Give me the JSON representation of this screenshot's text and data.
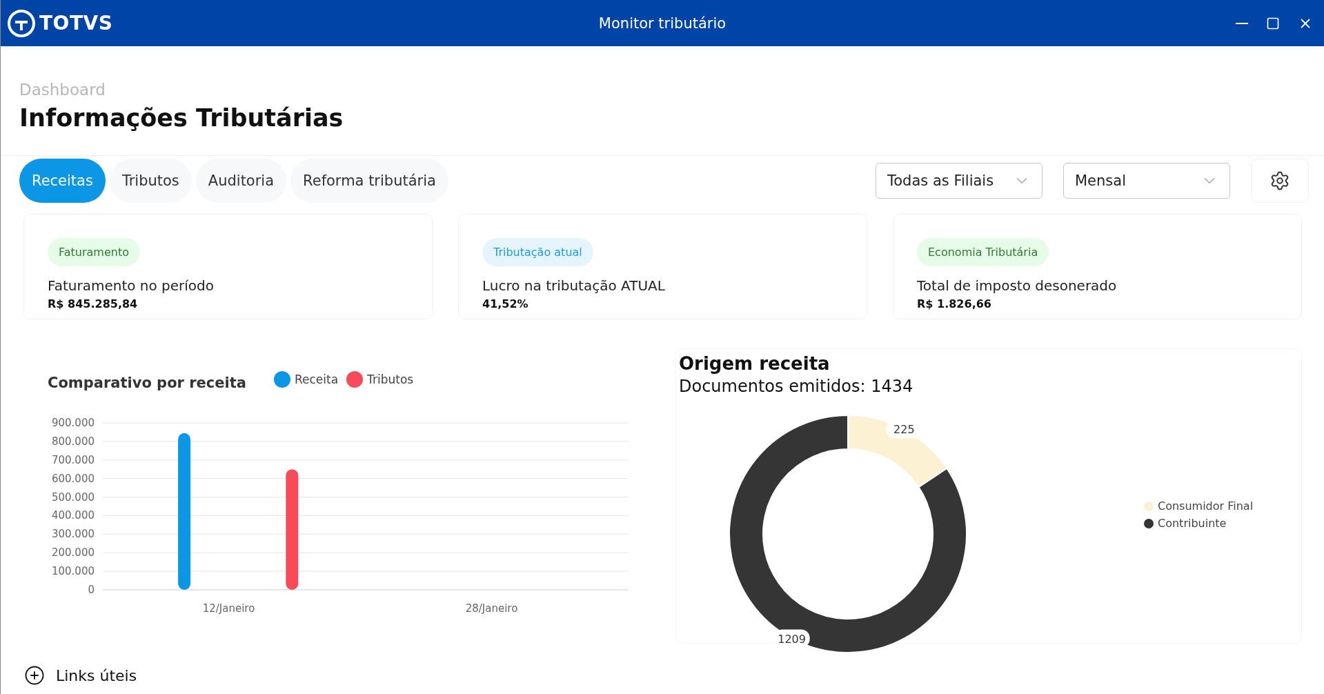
{
  "window": {
    "title": "Monitor tributário",
    "logo": "TOTVS"
  },
  "header": {
    "breadcrumb": "Dashboard",
    "title": "Informações Tributárias"
  },
  "tabs": [
    {
      "label": "Receitas",
      "selected": true
    },
    {
      "label": "Tributos",
      "selected": false
    },
    {
      "label": "Auditoria",
      "selected": false
    },
    {
      "label": "Reforma tributária",
      "selected": false
    }
  ],
  "filters": [
    {
      "value": "Todas as Filiais"
    },
    {
      "value": "Mensal"
    }
  ],
  "cards": [
    {
      "tag": "Faturamento",
      "color": "#2e7d32",
      "label": "Faturamento no período",
      "value": "R$ 845.285,84"
    },
    {
      "tag": "Tributação atual",
      "color": "#1e9be0",
      "label": "Lucro na tributação ATUAL",
      "value": "41,52%"
    },
    {
      "tag": "Economia Tributária",
      "color": "#2e7d32",
      "label": "Total de imposto desonerado",
      "value": "R$ 1.826,66"
    }
  ],
  "bar_panel": {
    "chart_data": {
      "type": "bar",
      "title": "Comparativo por receita",
      "categories": [
        "12/Janeiro",
        "28/Janeiro"
      ],
      "series": [
        {
          "name": "Receita",
          "color": "#0b97e6",
          "values": [
            845000,
            null
          ]
        },
        {
          "name": "Tributos",
          "color": "#f74b59",
          "values": [
            650000,
            null
          ]
        }
      ],
      "ylim": [
        0,
        900000
      ],
      "grid": true,
      "yticks": [
        {
          "value": 0,
          "label": "0"
        },
        {
          "value": 100000,
          "label": "100.000"
        },
        {
          "value": 200000,
          "label": "200.000"
        },
        {
          "value": 300000,
          "label": "300.000"
        },
        {
          "value": 400000,
          "label": "400.000"
        },
        {
          "value": 500000,
          "label": "500.000"
        },
        {
          "value": 600000,
          "label": "600.000"
        },
        {
          "value": 700000,
          "label": "700.000"
        },
        {
          "value": 800000,
          "label": "800.000"
        },
        {
          "value": 900000,
          "label": "900.000"
        }
      ]
    }
  },
  "donut_panel": {
    "title": "Origem receita",
    "subtitle": "Documentos emitidos: 1434",
    "chart_data": {
      "type": "donut",
      "categories": [
        "Consumidor Final",
        "Contribuinte"
      ],
      "values": [
        225,
        1209
      ],
      "colors": [
        "#fdf1d3",
        "#353535"
      ],
      "data_labels": true
    }
  },
  "links": {
    "label": "Links úteis"
  }
}
